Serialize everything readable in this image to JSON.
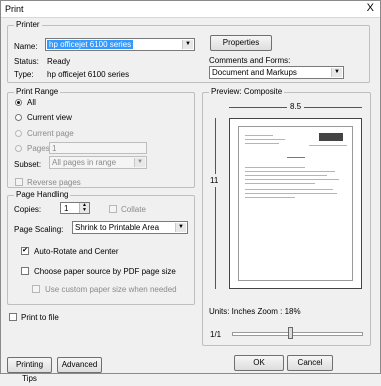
{
  "window": {
    "title": "Print",
    "close_glyph": "X"
  },
  "printer": {
    "group_label": "Printer",
    "name_label": "Name:",
    "name_value": "hp officejet 6100 series",
    "properties_button": "Properties",
    "status_label": "Status:",
    "status_value": "Ready",
    "type_label": "Type:",
    "type_value": "hp officejet 6100 series",
    "comments_label": "Comments and Forms:",
    "comments_value": "Document and Markups"
  },
  "print_range": {
    "group_label": "Print Range",
    "all": "All",
    "current_view": "Current view",
    "current_page": "Current page",
    "pages": "Pages",
    "pages_value": "1",
    "subset_label": "Subset:",
    "subset_value": "All pages in range",
    "reverse_pages": "Reverse pages",
    "selected": "All"
  },
  "page_handling": {
    "group_label": "Page Handling",
    "copies_label": "Copies:",
    "copies_value": "1",
    "collate": "Collate",
    "scaling_label": "Page Scaling:",
    "scaling_value": "Shrink to Printable Area",
    "auto_rotate": "Auto-Rotate and Center",
    "auto_rotate_checked": true,
    "choose_source": "Choose paper source by PDF page size",
    "choose_source_checked": false,
    "use_custom": "Use custom paper size when needed",
    "use_custom_checked": false
  },
  "print_to_file": {
    "label": "Print to file",
    "checked": false
  },
  "preview": {
    "group_label": "Preview: Composite",
    "width_label": "8.5",
    "height_label": "11",
    "units_zoom": "Units: Inches Zoom :  18%",
    "page_indicator": "1/1"
  },
  "buttons": {
    "printing_tips": "Printing Tips",
    "advanced": "Advanced",
    "ok": "OK",
    "cancel": "Cancel"
  },
  "colors": {
    "selection": "#3399ff",
    "window_bg": "#f0f0f0"
  }
}
